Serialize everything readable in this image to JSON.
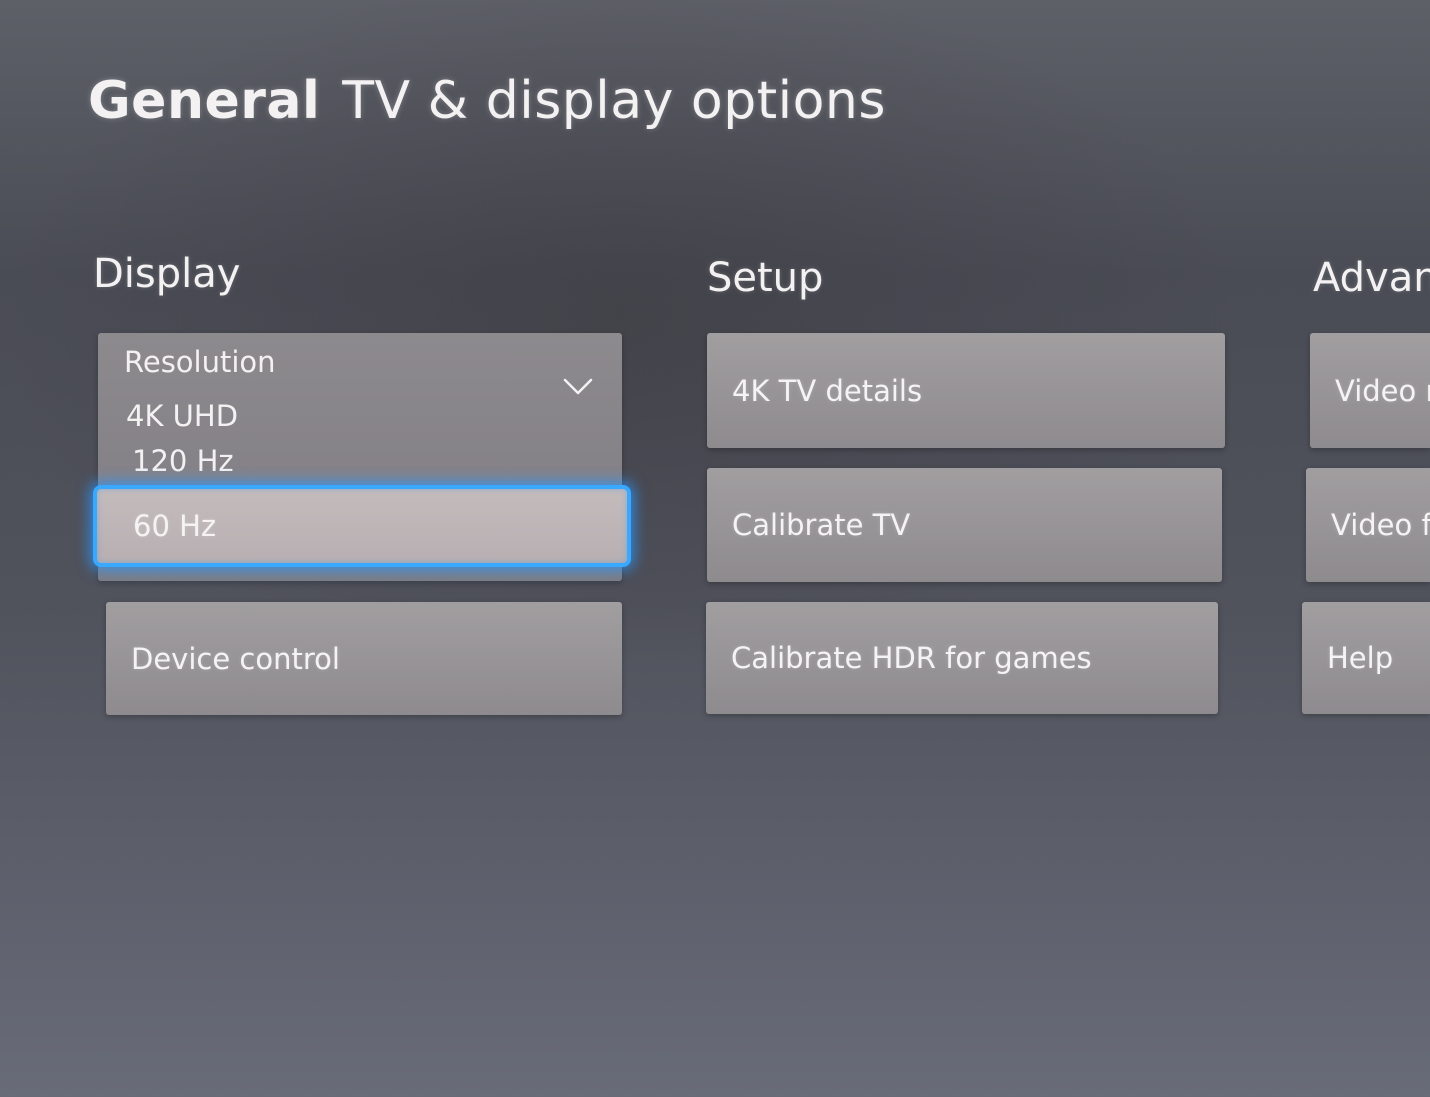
{
  "header": {
    "section": "General",
    "page": "TV & display options"
  },
  "columns": {
    "display": {
      "heading": "Display",
      "resolution": {
        "label": "Resolution",
        "options": [
          "4K UHD",
          "120 Hz",
          "60 Hz"
        ],
        "focused": "60 Hz"
      },
      "device_control": "Device control"
    },
    "setup": {
      "heading": "Setup",
      "items": [
        "4K TV details",
        "Calibrate TV",
        "Calibrate HDR for games"
      ]
    },
    "advanced": {
      "heading": "Advan",
      "items": [
        "Video r",
        "Video fi",
        "Help"
      ]
    }
  },
  "colors": {
    "focus_ring": "#39a9ff",
    "tile": "#9a979a",
    "background": "#50525c"
  },
  "icons": {
    "dropdown": "chevron-down-icon"
  }
}
